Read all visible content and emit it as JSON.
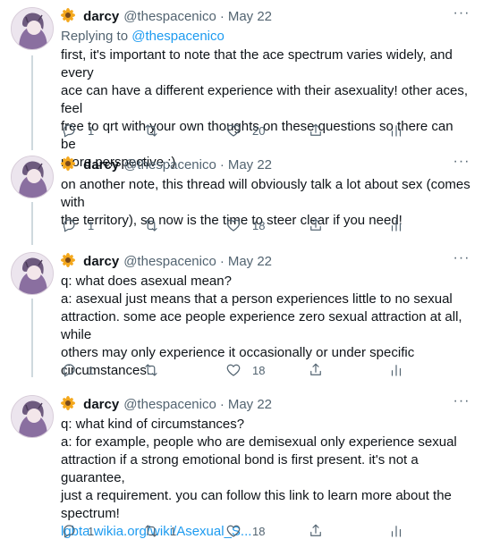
{
  "tweets": [
    {
      "name": "darcy",
      "handle": "@thespacenico",
      "separator": "·",
      "date": "May 22",
      "more": "···",
      "replying_prefix": "Replying to ",
      "replying_mention": "@thespacenico",
      "lines": [
        "first, it's important to note that the ace spectrum varies widely, and every",
        "ace can have a different experience with their asexuality! other aces, feel",
        "free to qrt with your own thoughts on these questions so there can be",
        "more perspective :)"
      ],
      "replies": "1",
      "retweets": "",
      "likes": "20"
    },
    {
      "name": "darcy",
      "handle": "@thespacenico",
      "separator": "·",
      "date": "May 22",
      "more": "···",
      "lines": [
        "on another note, this thread will obviously talk a lot about sex (comes with",
        "the territory), so now is the time to steer clear if you need!"
      ],
      "replies": "1",
      "retweets": "",
      "likes": "18"
    },
    {
      "name": "darcy",
      "handle": "@thespacenico",
      "separator": "·",
      "date": "May 22",
      "more": "···",
      "lines": [
        "q: what does asexual mean?",
        "a: asexual just means that a person experiences little to no sexual",
        "attraction. some ace people experience zero sexual attraction at all, while",
        "others may only experience it occasionally or under specific",
        "circumstances."
      ],
      "replies": "1",
      "retweets": "",
      "likes": "18"
    },
    {
      "name": "darcy",
      "handle": "@thespacenico",
      "separator": "·",
      "date": "May 22",
      "more": "···",
      "lines": [
        "q: what kind of circumstances?",
        "a: for example, people who are demisexual only experience sexual",
        "attraction if a strong emotional bond is first present. it's not a guarantee,",
        "just a requirement. you can follow this link to learn more about the",
        "spectrum!"
      ],
      "link": "lgbta.wikia.org/wiki/Asexual_S...",
      "replies": "1",
      "retweets": "1",
      "likes": "18"
    }
  ],
  "colors": {
    "link": "#1d9bf0",
    "secondary_text": "#536471",
    "thread_line": "#cfd9de"
  },
  "icons": [
    "sunflower-icon",
    "more-icon",
    "reply-icon",
    "retweet-icon",
    "like-icon",
    "share-icon",
    "analytics-icon"
  ]
}
